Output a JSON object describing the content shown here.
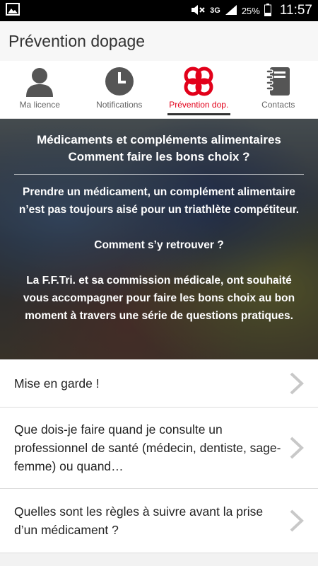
{
  "status_bar": {
    "battery": "25%",
    "time": "11:57",
    "network": "3G"
  },
  "app_bar": {
    "title": "Prévention dopage"
  },
  "tabs": [
    {
      "label": "Ma licence",
      "icon": "person-icon"
    },
    {
      "label": "Notifications",
      "icon": "clock-icon"
    },
    {
      "label": "Prévention dop.",
      "icon": "prevention-logo-icon",
      "active": true
    },
    {
      "label": "Contacts",
      "icon": "notebook-icon"
    }
  ],
  "hero": {
    "title_line1": "Médicaments et compléments alimentaires",
    "title_line2": "Comment faire les bons choix ?",
    "para1": "Prendre un médicament, un complément alimentaire n’est pas toujours aisé pour un triathlète compétiteur.",
    "para2": "Comment s’y retrouver ?",
    "para3": "La F.F.Tri. et sa commission médicale, ont souhaité vous accompagner pour faire les bons choix au bon moment à travers une série de questions pratiques."
  },
  "list": {
    "items": [
      {
        "text": "Mise en garde !"
      },
      {
        "text": "Que dois-je faire quand je consulte un professionnel de santé (médecin, dentiste, sage-femme) ou quand…"
      },
      {
        "text": "Quelles sont les règles à suivre avant la prise d’un médicament ?"
      }
    ]
  },
  "colors": {
    "accent": "#e2001a",
    "active_underline": "#333333"
  }
}
